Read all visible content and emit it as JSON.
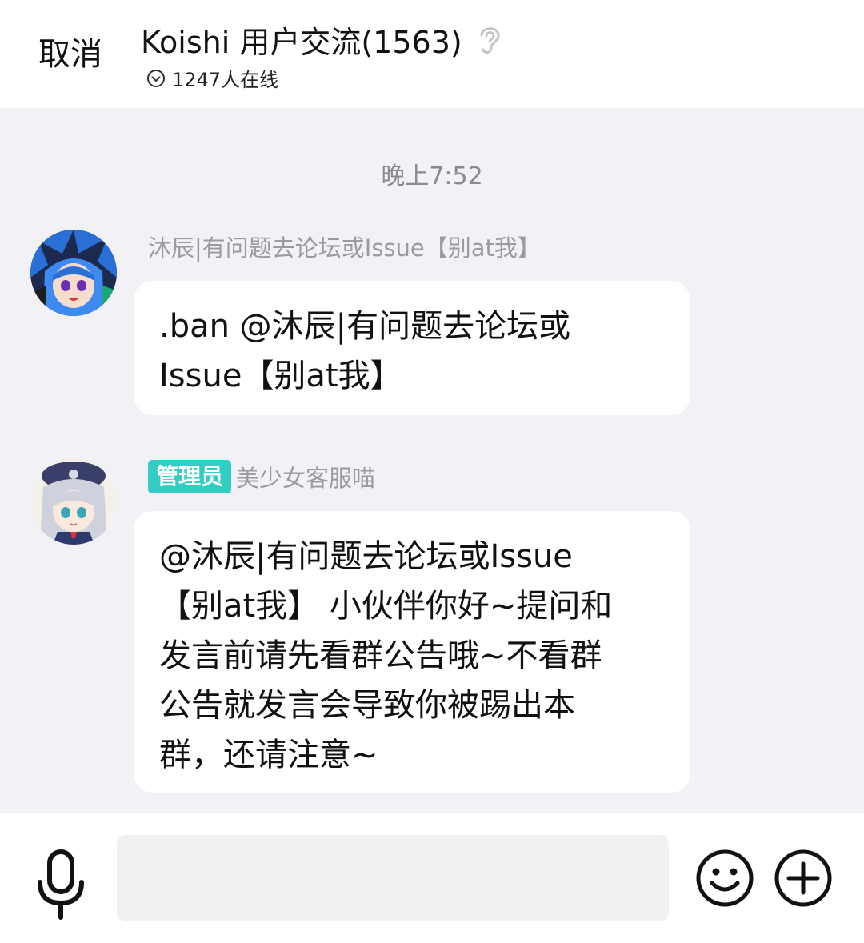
{
  "header": {
    "cancel_label": "取消",
    "title": "Koishi 用户交流(1563)",
    "online_count": "1247人在线",
    "ear_icon": "ear-icon",
    "online_icon": "chevron-down-circle-icon"
  },
  "chat": {
    "timestamp": "晚上7:52",
    "messages": [
      {
        "sender": "沐辰|有问题去论坛或Issue【别at我】",
        "role": "",
        "lines": [
          ".ban @沐辰|有问题去论坛或",
          "Issue【别at我】"
        ],
        "avatar_icon": "anime-avatar-blue-hair"
      },
      {
        "sender": "美少女客服喵",
        "role": "管理员",
        "lines": [
          "@沐辰|有问题去论坛或Issue",
          "【别at我】 小伙伴你好~提问和",
          "发言前请先看群公告哦~不看群",
          "公告就发言会导致你被踢出本",
          "群，还请注意~"
        ],
        "avatar_icon": "anime-avatar-silver-hair"
      }
    ]
  },
  "input_bar": {
    "placeholder": "",
    "mic_icon": "microphone-icon",
    "emoji_icon": "smiley-icon",
    "plus_icon": "plus-circle-icon"
  },
  "colors": {
    "background": "#f2f2f6",
    "bubble": "#ffffff",
    "admin_badge": "#33cdc4",
    "sender_name": "#9a9aa0"
  }
}
